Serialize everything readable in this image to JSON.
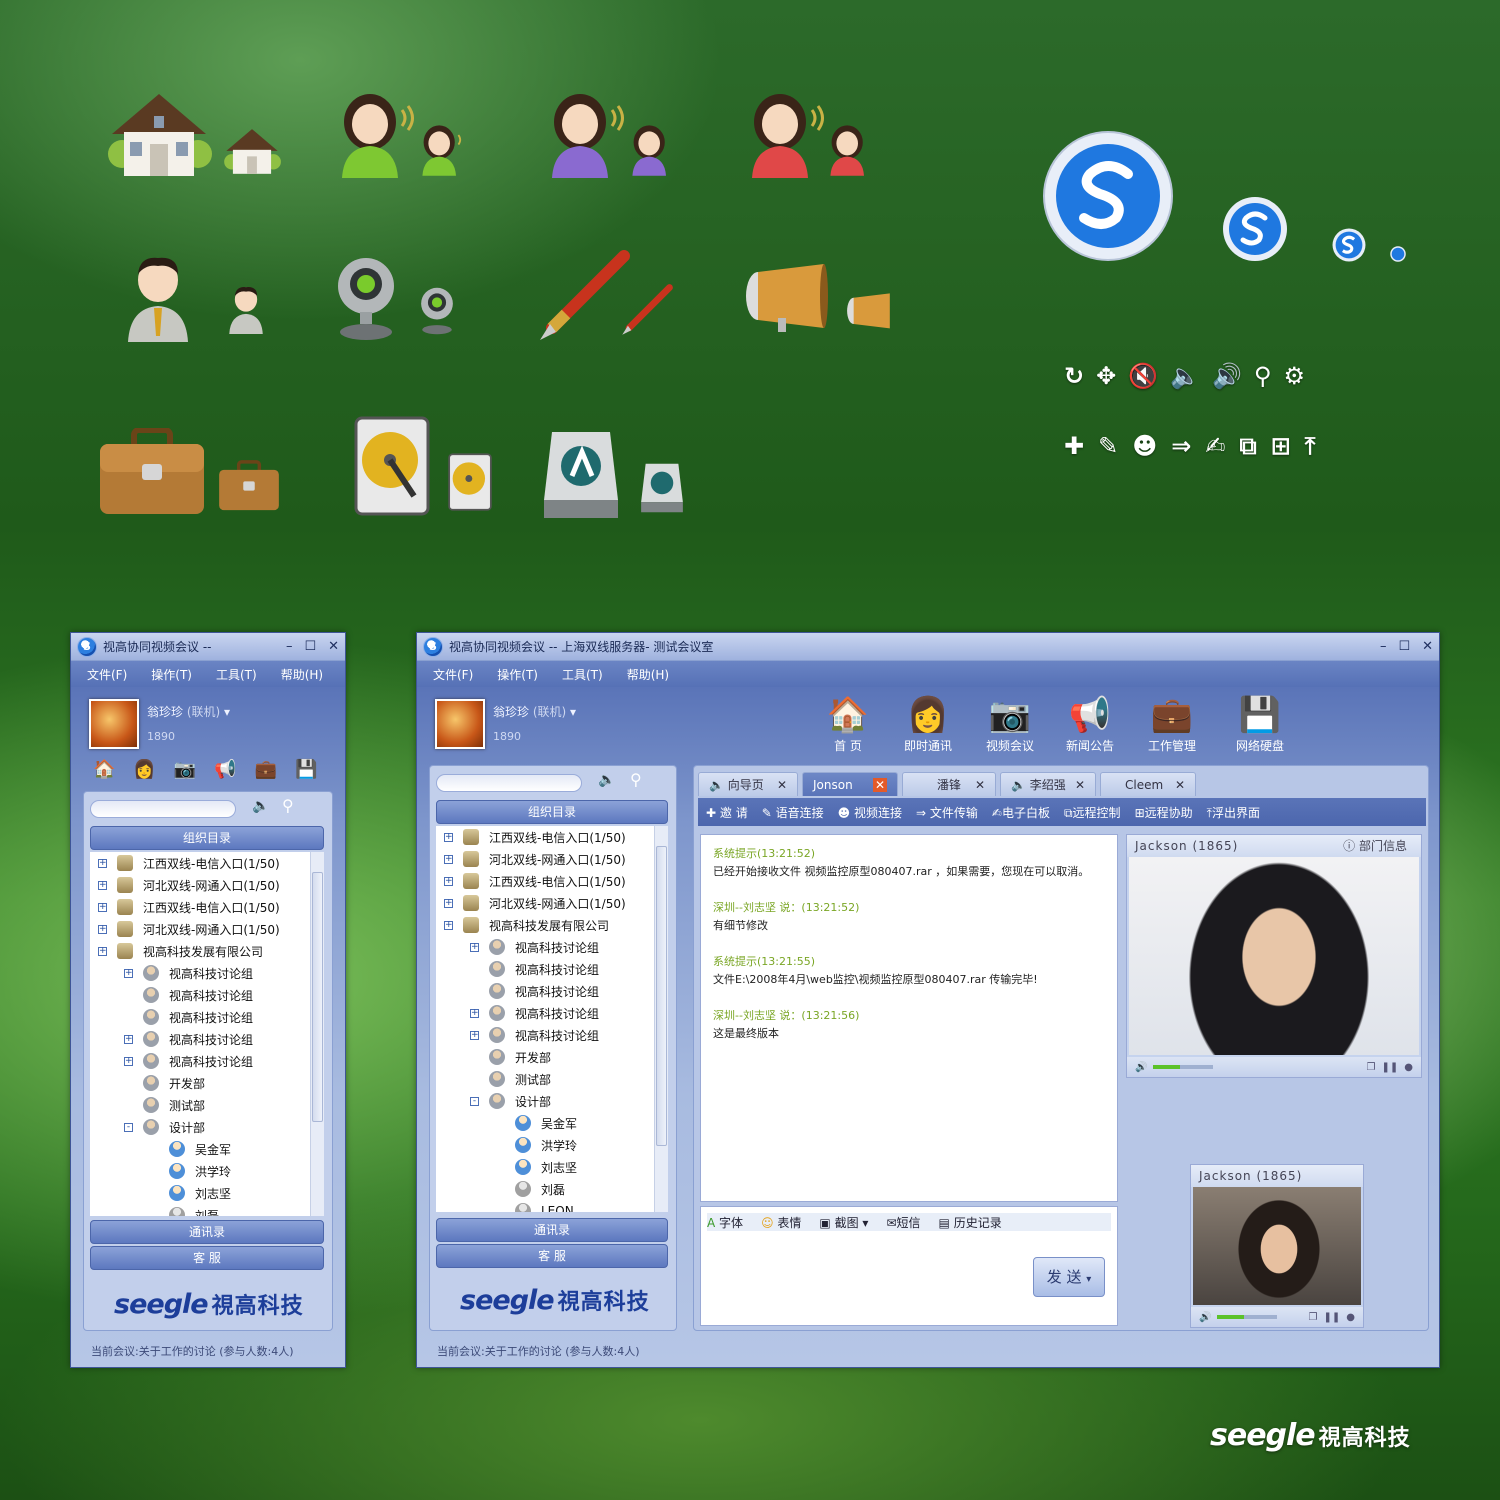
{
  "brand": {
    "logo_en": "seegle",
    "logo_cn": "視高科技"
  },
  "small_window": {
    "title": "视高协同视频会议 --",
    "menu": [
      "文件(F)",
      "操作(T)",
      "工具(T)",
      "帮助(H)"
    ],
    "user": {
      "name": "翁珍珍",
      "status": "(联机)",
      "id": "1890"
    },
    "panel_header": "组织目录",
    "tree": [
      {
        "label": "江西双线-电信入口(1/50)",
        "level": 0,
        "type": "org",
        "exp": "+"
      },
      {
        "label": "河北双线-网通入口(1/50)",
        "level": 0,
        "type": "org",
        "exp": "+"
      },
      {
        "label": "江西双线-电信入口(1/50)",
        "level": 0,
        "type": "org",
        "exp": "+"
      },
      {
        "label": "河北双线-网通入口(1/50)",
        "level": 0,
        "type": "org",
        "exp": "+"
      },
      {
        "label": "视高科技发展有限公司",
        "level": 0,
        "type": "org",
        "exp": "+"
      },
      {
        "label": "视高科技讨论组",
        "level": 1,
        "type": "grp",
        "exp": "+"
      },
      {
        "label": "视高科技讨论组",
        "level": 1,
        "type": "grp",
        "exp": ""
      },
      {
        "label": "视高科技讨论组",
        "level": 1,
        "type": "grp",
        "exp": ""
      },
      {
        "label": "视高科技讨论组",
        "level": 1,
        "type": "grp",
        "exp": "+"
      },
      {
        "label": "视高科技讨论组",
        "level": 1,
        "type": "grp",
        "exp": "+"
      },
      {
        "label": "开发部",
        "level": 1,
        "type": "grp",
        "exp": ""
      },
      {
        "label": "测试部",
        "level": 1,
        "type": "grp",
        "exp": ""
      },
      {
        "label": "设计部",
        "level": 1,
        "type": "grp",
        "exp": "-"
      },
      {
        "label": "吴金军",
        "level": 2,
        "type": "per",
        "exp": ""
      },
      {
        "label": "洪学玲",
        "level": 2,
        "type": "per",
        "exp": ""
      },
      {
        "label": "刘志坚",
        "level": 2,
        "type": "per",
        "exp": ""
      },
      {
        "label": "刘磊",
        "level": 2,
        "type": "off",
        "exp": ""
      }
    ],
    "btn_contacts": "通讯录",
    "btn_service": "客  服",
    "status": "当前会议:关于工作的讨论 (参与人数:4人)"
  },
  "main_window": {
    "title": "视高协同视频会议 -- 上海双线服务器- 测试会议室",
    "menu": [
      "文件(F)",
      "操作(T)",
      "工具(T)",
      "帮助(H)"
    ],
    "user": {
      "name": "翁珍珍",
      "status": "(联机)",
      "id": "1890"
    },
    "toolbar": [
      "首 页",
      "即时通讯",
      "视频会议",
      "新闻公告",
      "工作管理",
      "网络硬盘"
    ],
    "panel_header": "组织目录",
    "tree": [
      {
        "label": "江西双线-电信入口(1/50)",
        "level": 0,
        "type": "org",
        "exp": "+"
      },
      {
        "label": "河北双线-网通入口(1/50)",
        "level": 0,
        "type": "org",
        "exp": "+"
      },
      {
        "label": "江西双线-电信入口(1/50)",
        "level": 0,
        "type": "org",
        "exp": "+"
      },
      {
        "label": "河北双线-网通入口(1/50)",
        "level": 0,
        "type": "org",
        "exp": "+"
      },
      {
        "label": "视高科技发展有限公司",
        "level": 0,
        "type": "org",
        "exp": "+"
      },
      {
        "label": "视高科技讨论组",
        "level": 1,
        "type": "grp",
        "exp": "+"
      },
      {
        "label": "视高科技讨论组",
        "level": 1,
        "type": "grp",
        "exp": ""
      },
      {
        "label": "视高科技讨论组",
        "level": 1,
        "type": "grp",
        "exp": ""
      },
      {
        "label": "视高科技讨论组",
        "level": 1,
        "type": "grp",
        "exp": "+"
      },
      {
        "label": "视高科技讨论组",
        "level": 1,
        "type": "grp",
        "exp": "+"
      },
      {
        "label": "开发部",
        "level": 1,
        "type": "grp",
        "exp": ""
      },
      {
        "label": "测试部",
        "level": 1,
        "type": "grp",
        "exp": ""
      },
      {
        "label": "设计部",
        "level": 1,
        "type": "grp",
        "exp": "-"
      },
      {
        "label": "吴金军",
        "level": 2,
        "type": "per",
        "exp": ""
      },
      {
        "label": "洪学玲",
        "level": 2,
        "type": "per",
        "exp": ""
      },
      {
        "label": "刘志坚",
        "level": 2,
        "type": "per",
        "exp": ""
      },
      {
        "label": "刘磊",
        "level": 2,
        "type": "off",
        "exp": ""
      },
      {
        "label": "LEON",
        "level": 2,
        "type": "off",
        "exp": ""
      }
    ],
    "btn_contacts": "通讯录",
    "btn_service": "客  服",
    "tabs": [
      "向导页",
      "Jonson",
      "潘锋",
      "李绍强",
      "Cleem"
    ],
    "actions": [
      "邀 请",
      "语音连接",
      "视频连接",
      "文件传输",
      "电子白板",
      "远程控制",
      "远程协助",
      "浮出界面"
    ],
    "chat": [
      {
        "sys": "系统提示(13:21:52)",
        "msg": "已经开始接收文件 视频监控原型080407.rar ，如果需要，您现在可以取消。"
      },
      {
        "sys": "深圳--刘志坚 说：(13:21:52)",
        "msg": "有细节修改"
      },
      {
        "sys": "系统提示(13:21:55)",
        "msg": "文件E:\\2008年4月\\web监控\\视频监控原型080407.rar 传输完毕!"
      },
      {
        "sys": "深圳--刘志坚 说：(13:21:56)",
        "msg": "这是最终版本"
      }
    ],
    "input_tools": [
      "字体",
      "表情",
      "截图",
      "短信",
      "历史记录"
    ],
    "send": "发 送",
    "video_big": {
      "name": "Jackson (1865)",
      "info": "部门信息",
      "volume": 0.45
    },
    "video_small": {
      "name": "Jackson (1865)",
      "volume": 0.45
    },
    "status": "当前会议:关于工作的讨论 (参与人数:4人)"
  },
  "icons_big": [
    "home-icon",
    "user-green-icon",
    "user-purple-icon",
    "user-red-icon",
    "user-male-icon",
    "webcam-icon",
    "pen-icon",
    "megaphone-icon",
    "briefcase-icon",
    "hard-disk-icon",
    "network-drive-icon",
    "seegle-logo-icon"
  ],
  "glyphs_row1": [
    "refresh-icon",
    "move-icon",
    "mute-icon",
    "volume-low-icon",
    "volume-high-icon",
    "search-icon",
    "settings-icon"
  ],
  "glyphs_row2": [
    "add-icon",
    "microphone-icon",
    "person-icon",
    "file-transfer-icon",
    "whiteboard-icon",
    "remote-control-icon",
    "remote-assist-icon",
    "float-out-icon"
  ]
}
